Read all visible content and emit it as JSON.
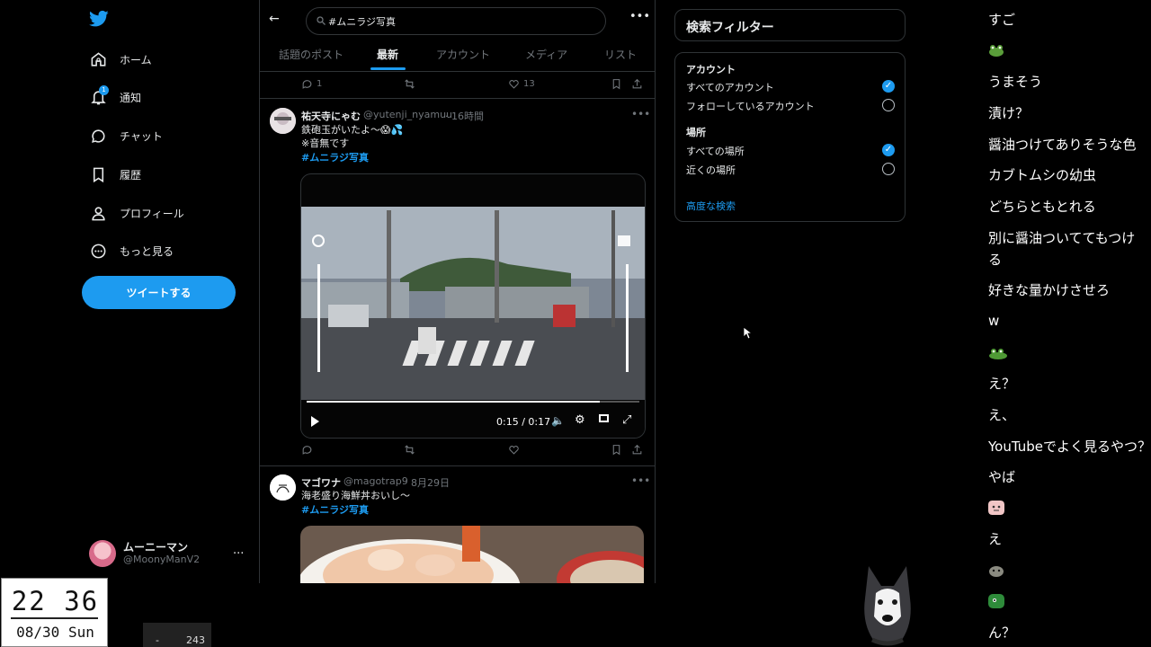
{
  "nav": {
    "items": [
      {
        "label": "ホーム",
        "icon": "home-icon"
      },
      {
        "label": "通知",
        "icon": "bell-icon",
        "badge": "1"
      },
      {
        "label": "チャット",
        "icon": "chat-icon"
      },
      {
        "label": "履歴",
        "icon": "bookmark-icon"
      },
      {
        "label": "プロフィール",
        "icon": "person-icon"
      },
      {
        "label": "もっと見る",
        "icon": "more-circle-icon"
      }
    ],
    "tweet_button": "ツイートする",
    "account": {
      "name": "ムーニーマン",
      "handle": "@MoonyManV2",
      "more": "..."
    }
  },
  "clock": {
    "time": "22 36",
    "date": "08/30 Sun"
  },
  "counter": {
    "dash": "-",
    "value": "243"
  },
  "search": {
    "query": "#ムニラジ写真"
  },
  "tabs": [
    "話題のポスト",
    "最新",
    "アカウント",
    "メディア",
    "リスト"
  ],
  "active_tab": "最新",
  "prev_tweet_actions": {
    "replies": "1",
    "likes": "13"
  },
  "tweets": [
    {
      "name": "祐天寺にゃむ",
      "handle": "@yutenji_nyamuu",
      "time": "· 16時間",
      "text1": "鉄砲玉がいたよ〜😱💦",
      "text2": "※音無です",
      "hashtag": "#ムニラジ写真",
      "video_time": "0:15 / 0:17",
      "video_progress": 0.88
    },
    {
      "name": "マゴワナ",
      "handle": "@magotrap9",
      "time": "· 8月29日",
      "text1": "海老盛り海鮮丼おいし〜",
      "hashtag": "#ムニラジ写真"
    }
  ],
  "filter": {
    "title": "検索フィルター",
    "account_label": "アカウント",
    "account_all": "すべてのアカウント",
    "account_follow": "フォローしているアカウント",
    "place_label": "場所",
    "place_all": "すべての場所",
    "place_near": "近くの場所",
    "advanced": "高度な検索"
  },
  "chat": [
    "すご",
    "うまそう",
    "漬け？",
    "醤油つけてありそうな色",
    "カブトムシの幼虫",
    "どちらともとれる",
    "別に醤油ついててもつけ",
    "る",
    "好きな量かけさせろ",
    "w",
    "え？",
    "え、",
    "YouTubeでよく見るやつ？",
    "やば",
    "え",
    "ん？"
  ]
}
